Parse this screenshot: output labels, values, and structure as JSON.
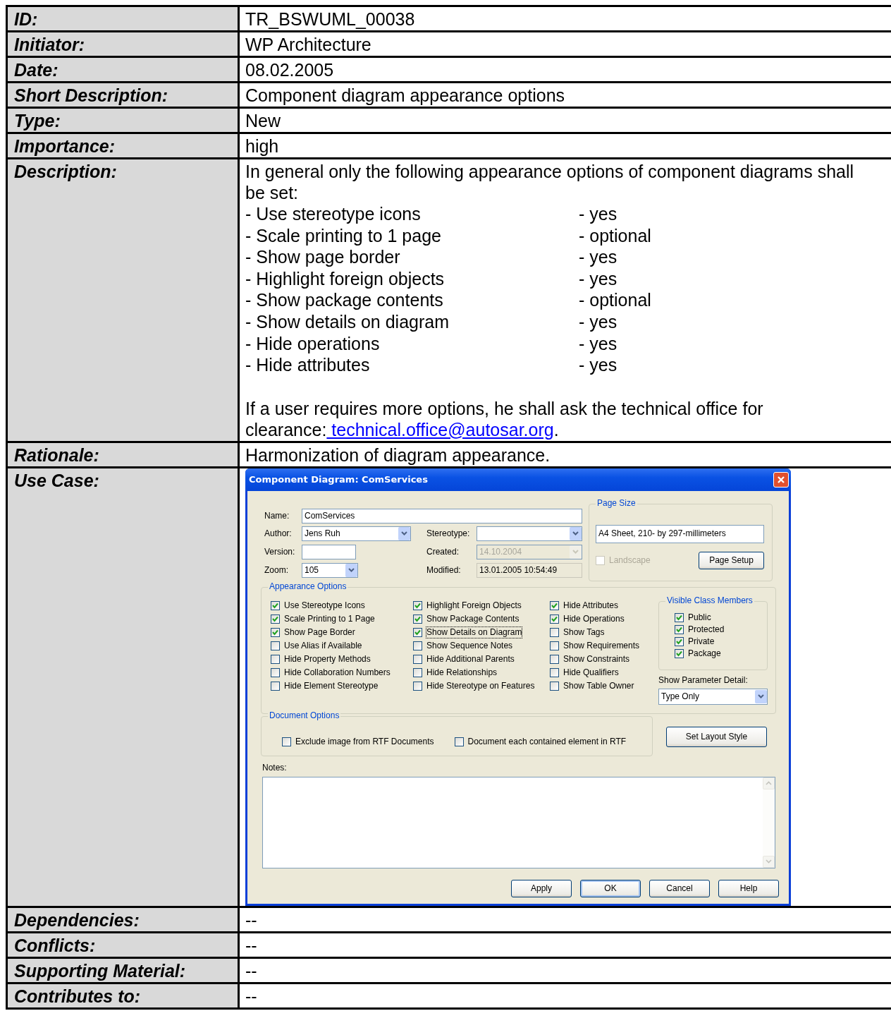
{
  "table": {
    "rows": [
      {
        "kind": "text",
        "label": "ID:",
        "value": "TR_BSWUML_00038"
      },
      {
        "kind": "text",
        "label": "Initiator:",
        "value": "WP Architecture"
      },
      {
        "kind": "text",
        "label": "Date:",
        "value": "08.02.2005"
      },
      {
        "kind": "text",
        "label": "Short Description:",
        "value": "Component diagram appearance options"
      },
      {
        "kind": "text",
        "label": "Type:",
        "value": "New"
      },
      {
        "kind": "text",
        "label": "Importance:",
        "value": "high"
      },
      {
        "kind": "description",
        "label": "Description:",
        "intro": "In general only the following appearance options of component diagrams shall be set:",
        "options": [
          {
            "option": "- Use stereotype icons",
            "value": "- yes"
          },
          {
            "option": "- Scale printing to 1 page",
            "value": "- optional"
          },
          {
            "option": "- Show page border",
            "value": "- yes"
          },
          {
            "option": "- Highlight foreign objects",
            "value": "- yes"
          },
          {
            "option": "- Show package contents",
            "value": "- optional"
          },
          {
            "option": "- Show details on diagram",
            "value": "- yes"
          },
          {
            "option": "- Hide operations",
            "value": "- yes"
          },
          {
            "option": "- Hide attributes",
            "value": "- yes"
          }
        ],
        "note": "If a user requires more options, he shall ask the technical office for clearance:",
        "note_link": " technical.office@autosar.org",
        "note_end": "."
      },
      {
        "kind": "text",
        "label": "Rationale:",
        "value": "Harmonization of diagram appearance."
      },
      {
        "kind": "dialog",
        "label": "Use Case:"
      },
      {
        "kind": "text",
        "label": "Dependencies:",
        "value": "--"
      },
      {
        "kind": "text",
        "label": "Conflicts:",
        "value": "--"
      },
      {
        "kind": "text",
        "label": "Supporting Material:",
        "value": "--"
      },
      {
        "kind": "text",
        "label": "Contributes to:",
        "value": "--"
      }
    ]
  },
  "dialog": {
    "title": "Component Diagram: ComServices",
    "name": {
      "label": "Name:",
      "value": "ComServices"
    },
    "left_fields": [
      {
        "kind": "combo",
        "label": "Author:",
        "value": "Jens Ruh",
        "disabled": false
      },
      {
        "kind": "text",
        "label": "Version:",
        "disabled": false
      },
      {
        "kind": "combo",
        "label": "Zoom:",
        "value": "105",
        "disabled": false
      }
    ],
    "right_fields": [
      {
        "kind": "combo",
        "label": "Stereotype:",
        "disabled": false
      },
      {
        "kind": "combo",
        "label": "Created:",
        "value": "14.10.2004",
        "disabled": true
      },
      {
        "kind": "text",
        "label": "Modified:",
        "value": "13.01.2005 10:54:49",
        "disabled": true
      }
    ],
    "page_size": {
      "title": "Page Size",
      "value": "A4 Sheet, 210- by 297-millimeters",
      "landscape": {
        "label": "Landscape",
        "checked": false,
        "disabled": true
      },
      "button": "Page Setup"
    },
    "appearance": {
      "title": "Appearance Options",
      "columns": [
        [
          {
            "label": "Use Stereotype Icons",
            "checked": true,
            "focused": false
          },
          {
            "label": "Scale Printing to 1 Page",
            "checked": true,
            "focused": false
          },
          {
            "label": "Show Page Border",
            "checked": true,
            "focused": false
          },
          {
            "label": "Use Alias if Available",
            "checked": false,
            "focused": false
          },
          {
            "label": "Hide Property Methods",
            "checked": false,
            "focused": false
          },
          {
            "label": "Hide Collaboration Numbers",
            "checked": false,
            "focused": false
          },
          {
            "label": "Hide Element Stereotype",
            "checked": false,
            "focused": false
          }
        ],
        [
          {
            "label": "Highlight Foreign Objects",
            "checked": true,
            "focused": false
          },
          {
            "label": "Show Package Contents",
            "checked": true,
            "focused": false
          },
          {
            "label": "Show Details on Diagram",
            "checked": true,
            "focused": true
          },
          {
            "label": "Show Sequence Notes",
            "checked": false,
            "focused": false
          },
          {
            "label": "Hide Additional Parents",
            "checked": false,
            "focused": false
          },
          {
            "label": "Hide Relationships",
            "checked": false,
            "focused": false
          },
          {
            "label": "Hide Stereotype on Features",
            "checked": false,
            "focused": false
          }
        ],
        [
          {
            "label": "Hide Attributes",
            "checked": true,
            "focused": false
          },
          {
            "label": "Hide Operations",
            "checked": true,
            "focused": false
          },
          {
            "label": "Show Tags",
            "checked": false,
            "focused": false
          },
          {
            "label": "Show Requirements",
            "checked": false,
            "focused": false
          },
          {
            "label": "Show Constraints",
            "checked": false,
            "focused": false
          },
          {
            "label": "Hide Qualifiers",
            "checked": false,
            "focused": false
          },
          {
            "label": "Show Table Owner",
            "checked": false,
            "focused": false
          }
        ]
      ],
      "visible_members": {
        "title": "Visible Class Members",
        "items": [
          {
            "label": "Public",
            "checked": true
          },
          {
            "label": "Protected",
            "checked": true
          },
          {
            "label": "Private",
            "checked": true
          },
          {
            "label": "Package",
            "checked": true
          }
        ]
      },
      "parameter_detail": {
        "label": "Show Parameter Detail:",
        "value": "Type Only"
      }
    },
    "document_options": {
      "title": "Document Options",
      "items": [
        {
          "label": "Exclude image from RTF Documents",
          "checked": false
        },
        {
          "label": "Document each contained element in RTF",
          "checked": false
        }
      ]
    },
    "layout_button": "Set Layout Style",
    "notes": {
      "label": "Notes:"
    },
    "buttons": [
      {
        "label": "Apply",
        "default": false
      },
      {
        "label": "OK",
        "default": true
      },
      {
        "label": "Cancel",
        "default": false
      },
      {
        "label": "Help",
        "default": false
      }
    ]
  }
}
